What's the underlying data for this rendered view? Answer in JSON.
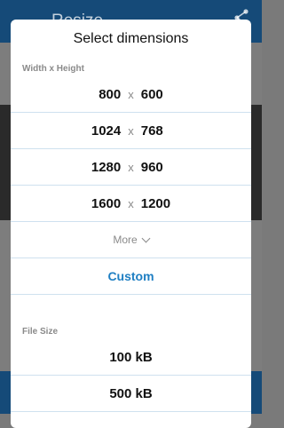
{
  "background": {
    "title": "Resize",
    "back_icon": "arrow-left-icon",
    "share_icon": "share-icon"
  },
  "dialog": {
    "title": "Select dimensions",
    "dimensions_label": "Width x Height",
    "separator": "x",
    "dimensions": [
      {
        "width": "800",
        "height": "600"
      },
      {
        "width": "1024",
        "height": "768"
      },
      {
        "width": "1280",
        "height": "960"
      },
      {
        "width": "1600",
        "height": "1200"
      }
    ],
    "more_label": "More",
    "custom_label": "Custom",
    "file_size_label": "File Size",
    "file_sizes": [
      "100 kB",
      "500 kB"
    ]
  },
  "colors": {
    "appbar": "#154a78",
    "accent": "#1f7fc3",
    "divider": "#cfe1ef",
    "label_gray": "#8a8a8a"
  }
}
